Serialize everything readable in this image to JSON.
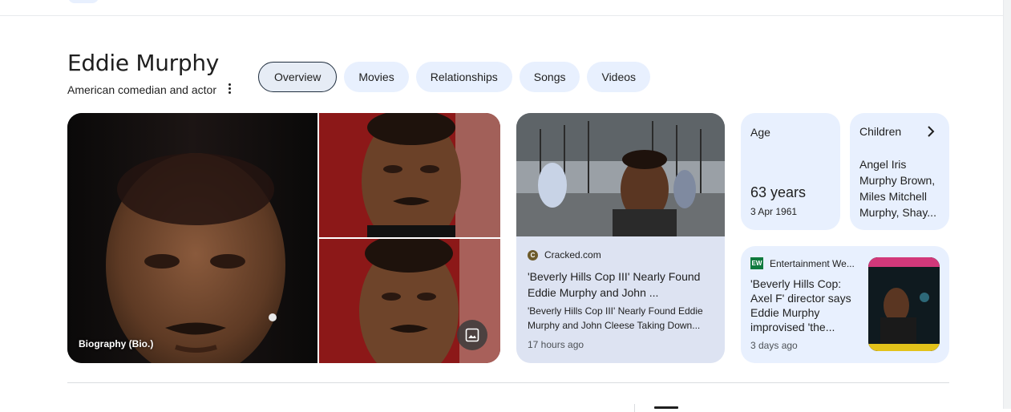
{
  "entity": {
    "name": "Eddie Murphy",
    "description": "American comedian and actor"
  },
  "tabs": [
    {
      "label": "Overview",
      "active": true
    },
    {
      "label": "Movies",
      "active": false
    },
    {
      "label": "Relationships",
      "active": false
    },
    {
      "label": "Songs",
      "active": false
    },
    {
      "label": "Videos",
      "active": false
    }
  ],
  "images": {
    "main_caption": "Biography (Bio.)",
    "more_images_icon": "image-gallery-icon"
  },
  "news_card_1": {
    "source": "Cracked.com",
    "source_icon": "C",
    "headline": "'Beverly Hills Cop III' Nearly Found Eddie Murphy and John ...",
    "snippet": "'Beverly Hills Cop III' Nearly Found Eddie Murphy and John Cleese Taking Down...",
    "time": "17 hours ago"
  },
  "age_card": {
    "label": "Age",
    "value": "63 years",
    "birth_date": "3 Apr 1961"
  },
  "children_card": {
    "label": "Children",
    "value": "Angel Iris Murphy Brown, Miles Mitchell Murphy, Shay..."
  },
  "news_card_2": {
    "source": "Entertainment We...",
    "source_icon": "EW",
    "headline": "'Beverly Hills Cop: Axel F' director says Eddie Murphy improvised 'the...",
    "time": "3 days ago"
  },
  "colors": {
    "chip_bg": "#e8f0fe",
    "news_bg": "#dde3f2",
    "text": "#1f1f1f",
    "muted": "#4d5156"
  }
}
